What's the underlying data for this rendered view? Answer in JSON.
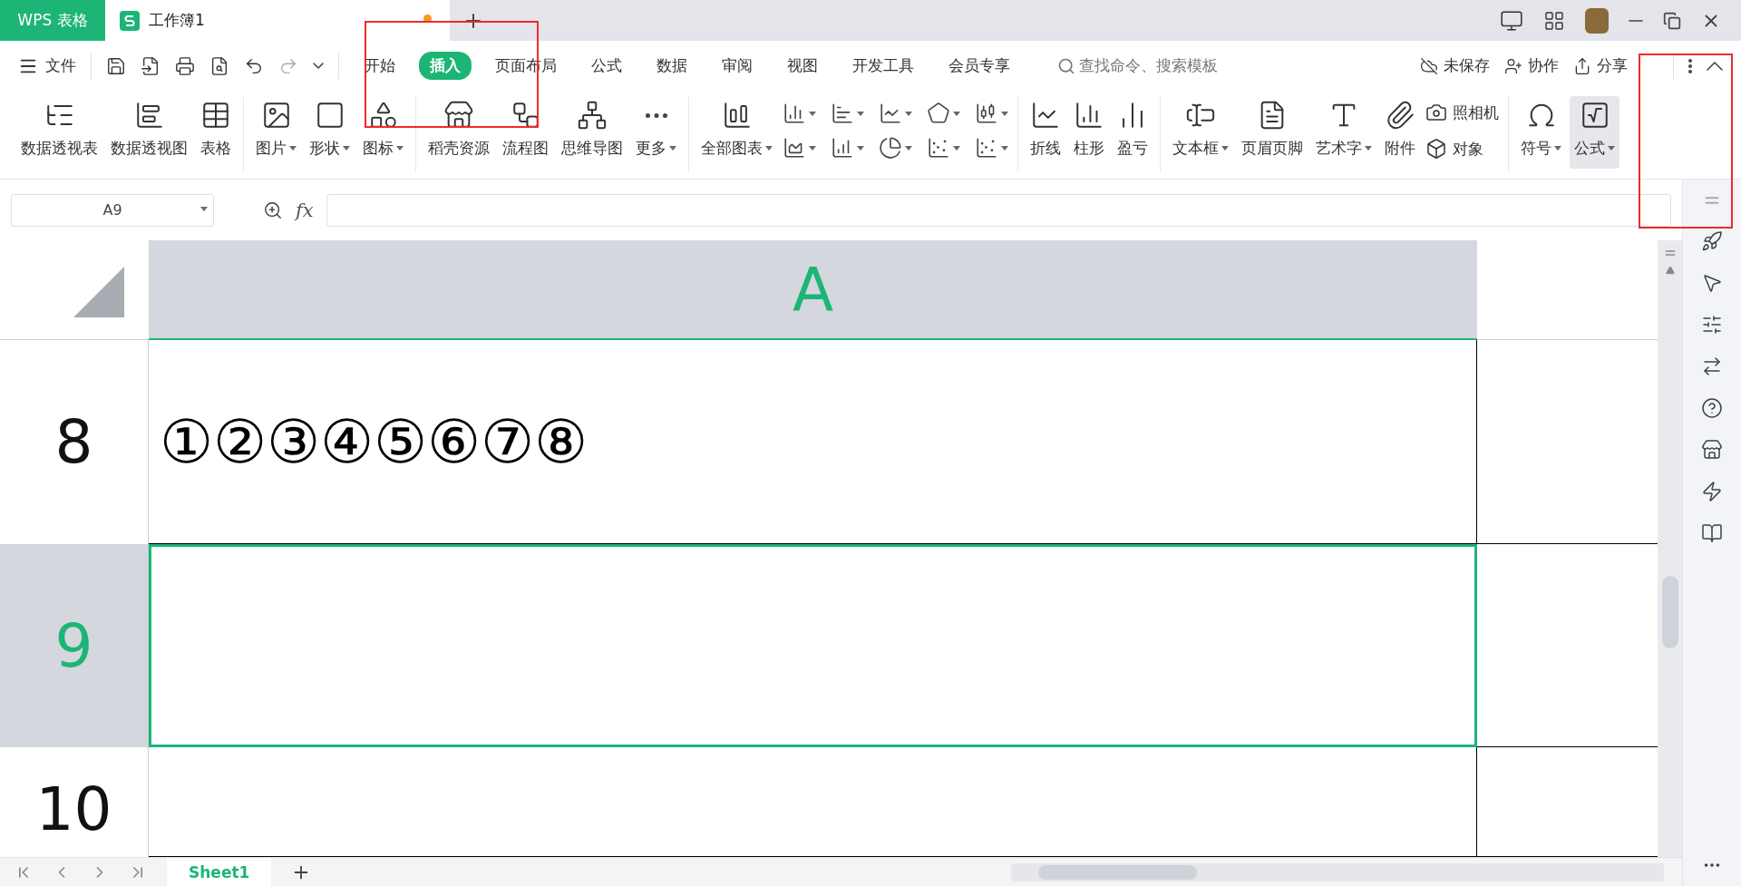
{
  "app_tab": "WPS 表格",
  "document_tab": {
    "title": "工作簿1",
    "unsaved": true
  },
  "toolbar_menu": {
    "file": "文件"
  },
  "menu_tabs": [
    {
      "label": "开始",
      "selected": false
    },
    {
      "label": "插入",
      "selected": true
    },
    {
      "label": "页面布局",
      "selected": false
    },
    {
      "label": "公式",
      "selected": false
    },
    {
      "label": "数据",
      "selected": false
    },
    {
      "label": "审阅",
      "selected": false
    },
    {
      "label": "视图",
      "selected": false
    },
    {
      "label": "开发工具",
      "selected": false
    },
    {
      "label": "会员专享",
      "selected": false
    }
  ],
  "search": {
    "placeholder": "查找命令、搜索模板"
  },
  "actions": [
    "未保存",
    "协作",
    "分享"
  ],
  "ribbon": [
    {
      "items": [
        {
          "kind": "large",
          "label": "数据透视表",
          "dropdown": false
        },
        {
          "kind": "large",
          "label": "数据透视图",
          "dropdown": false
        },
        {
          "kind": "large",
          "label": "表格",
          "dropdown": false
        }
      ]
    },
    {
      "items": [
        {
          "kind": "large",
          "label": "图片",
          "dropdown": true
        },
        {
          "kind": "large",
          "label": "形状",
          "dropdown": true
        },
        {
          "kind": "large",
          "label": "图标",
          "dropdown": true
        }
      ]
    },
    {
      "items": [
        {
          "kind": "large",
          "label": "稻壳资源",
          "dropdown": false
        },
        {
          "kind": "large",
          "label": "流程图",
          "dropdown": false
        },
        {
          "kind": "large",
          "label": "思维导图",
          "dropdown": false
        },
        {
          "kind": "large",
          "label": "更多",
          "dropdown": true
        }
      ]
    },
    {
      "items": [
        {
          "kind": "large",
          "label": "全部图表",
          "dropdown": true
        },
        {
          "kind": "grid",
          "cells": [
            {
              "dropdown": true
            },
            {
              "dropdown": true
            },
            {
              "dropdown": true
            },
            {
              "dropdown": true
            },
            {
              "dropdown": true
            },
            {
              "dropdown": true
            },
            {
              "dropdown": true
            },
            {
              "dropdown": true
            },
            {
              "dropdown": true
            },
            {
              "dropdown": true
            }
          ]
        }
      ]
    },
    {
      "items": [
        {
          "kind": "large",
          "label": "折线",
          "dropdown": false
        },
        {
          "kind": "large",
          "label": "柱形",
          "dropdown": false
        },
        {
          "kind": "large",
          "label": "盈亏",
          "dropdown": false
        }
      ]
    },
    {
      "items": [
        {
          "kind": "large",
          "label": "文本框",
          "dropdown": true
        },
        {
          "kind": "large",
          "label": "页眉页脚",
          "dropdown": false
        },
        {
          "kind": "large",
          "label": "艺术字",
          "dropdown": true
        },
        {
          "kind": "large",
          "label": "附件",
          "dropdown": false
        },
        {
          "kind": "stack",
          "entries": [
            {
              "label": "照相机"
            },
            {
              "label": "对象"
            }
          ]
        }
      ]
    },
    {
      "items": [
        {
          "kind": "large",
          "label": "符号",
          "dropdown": true,
          "hovered": false
        },
        {
          "kind": "large",
          "label": "公式",
          "dropdown": true,
          "hovered": true
        }
      ]
    }
  ],
  "formula_bar": {
    "name_box": "A9",
    "fx": "fx"
  },
  "columns": [
    {
      "label": "A",
      "selected": true
    }
  ],
  "rows": [
    {
      "number": "8",
      "selected": false,
      "cell": "①②③④⑤⑥⑦⑧"
    },
    {
      "number": "9",
      "selected": true
    },
    {
      "number": "10",
      "selected": false
    }
  ],
  "sheet_tabs": [
    {
      "label": "Sheet1",
      "selected": true
    }
  ]
}
